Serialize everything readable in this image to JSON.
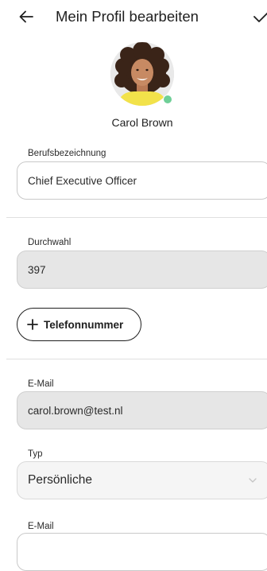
{
  "header": {
    "title": "Mein Profil bearbeiten",
    "back_icon": "arrow-left-icon",
    "confirm_icon": "checkmark-icon"
  },
  "profile": {
    "name": "Carol Brown",
    "status_color": "#6fcf97"
  },
  "fields": {
    "job_title": {
      "label": "Berufsbezeichnung",
      "value": "Chief Executive Officer"
    },
    "extension": {
      "label": "Durchwahl",
      "value": "397"
    },
    "add_phone_label": "Telefonnummer",
    "email": {
      "label": "E-Mail",
      "value": "carol.brown@test.nl"
    },
    "type": {
      "label": "Typ",
      "value": "Persönliche"
    },
    "email2": {
      "label": "E-Mail",
      "value": ""
    }
  }
}
